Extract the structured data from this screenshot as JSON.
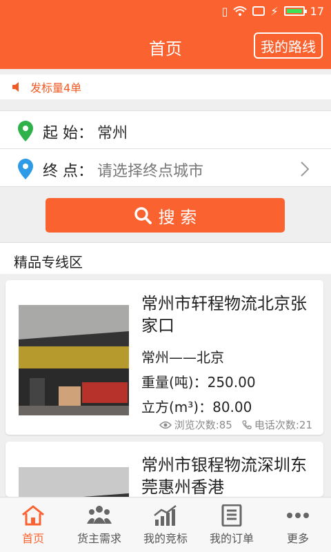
{
  "status_bar": {
    "time": "17"
  },
  "header": {
    "title": "首页",
    "route_button": "我的路线"
  },
  "notice": {
    "text": "发标量4单"
  },
  "form": {
    "start_label": "起 始：",
    "start_value": "常州",
    "end_label": "终 点：",
    "end_placeholder": "请选择终点城市",
    "search_label": "搜 索"
  },
  "section": {
    "title": "精品专线区"
  },
  "cards": [
    {
      "title": "常州市轩程物流北京张家口",
      "route": "常州——北京",
      "weight": "重量(吨)：250.00",
      "volume": "立方(m³)：80.00",
      "views": "浏览次数:85",
      "calls": "电话次数:21"
    },
    {
      "title": "常州市银程物流深圳东莞惠州香港"
    }
  ],
  "tabs": [
    {
      "label": "首页",
      "icon": "home-icon"
    },
    {
      "label": "货主需求",
      "icon": "people-icon"
    },
    {
      "label": "我的竞标",
      "icon": "chart-icon"
    },
    {
      "label": "我的订单",
      "icon": "document-icon"
    },
    {
      "label": "更多",
      "icon": "more-icon"
    }
  ],
  "colors": {
    "accent": "#fa6330",
    "pin_start": "#2fb24a",
    "pin_end": "#2e9be6"
  }
}
